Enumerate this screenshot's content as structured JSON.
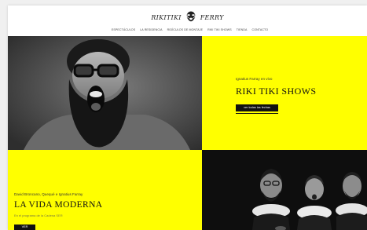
{
  "header": {
    "logo_left": "RIKITIKI",
    "logo_right": "FERRY"
  },
  "nav": [
    "Espectáculos",
    "La Residencia",
    "Ridículos de montaje",
    "Riki Tiki Shows",
    "Tienda",
    "Contacto"
  ],
  "tiles": {
    "riki": {
      "kicker": "Ignatius Farray en vivo",
      "title": "RIKI TIKI SHOWS",
      "button": "ver todas las fechas"
    },
    "vida": {
      "kicker": "David Broncano, Quequé e Ignatius Farray",
      "title": "LA VIDA MODERNA",
      "subtitle": "En el programa de la Cadena SER",
      "button": "VER"
    }
  },
  "colors": {
    "accent_yellow": "#ffff00",
    "dark": "#111111"
  }
}
